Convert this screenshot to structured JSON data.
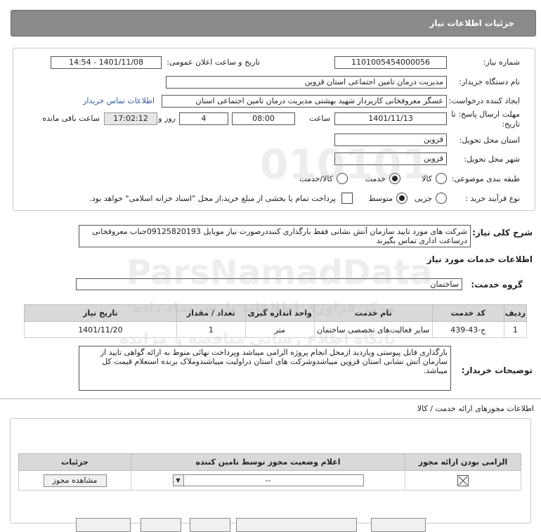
{
  "header": {
    "title": "جزئیات اطلاعات نیاز"
  },
  "form": {
    "need_number_label": "شماره نیاز:",
    "need_number": "1101005454000056",
    "announce_label": "تاریخ و ساعت اعلان عمومی:",
    "announce_value": "1401/11/08 - 14:54",
    "buyer_label": "نام دستگاه خریدار:",
    "buyer_value": "مدیریت درمان تامین اجتماعی استان قزوین",
    "creator_label": "ایجاد کننده درخواست:",
    "creator_value": "عسگر معروفخانی کارپرداز شهید بهشتی مدیریت درمان تامین اجتماعی استان",
    "contact_link": "اطلاعات تماس خریدار",
    "deadline_label": "مهلت ارسال پاسخ: تا تاریخ:",
    "deadline_date": "1401/11/13",
    "time_label": "ساعت",
    "deadline_time": "08:00",
    "days_value": "4",
    "days_label": "روز و",
    "remaining_time": "17:02:12",
    "remaining_label": "ساعت باقی مانده",
    "province_label": "استان محل تحویل:",
    "province_value": "قزوین",
    "city_label": "شهر محل تحویل:",
    "city_value": "قزوین",
    "category_label": "طبقه بندی موضوعی:",
    "category_options": [
      "کالا",
      "خدمت",
      "کالا/خدمت"
    ],
    "process_label": "نوع فرآیند خرید :",
    "process_options": [
      "جزیی",
      "متوسط"
    ],
    "payment_note": "پرداخت تمام یا بخشی از مبلغ خرید،از محل \"اسناد خزانه اسلامی\" خواهد بود."
  },
  "description": {
    "label": "شرح کلی نیاز:",
    "text": "شرکت های مورد تایید سازمان آتش نشانی فقط بارگذاری کنند‌درصورت نیاز موبایل 09125820193جناب معروفخانی درساعت اداری تماس بگیرند"
  },
  "services": {
    "section_title": "اطلاعات خدمات مورد نیاز",
    "group_label": "گروه خدمت:",
    "group_value": "ساختمان",
    "columns": [
      "ردیف",
      "کد خدمت",
      "نام خدمت",
      "واحد اندازه گیری",
      "تعداد / مقدار",
      "تاریخ نیاز"
    ],
    "rows": [
      [
        "1",
        "ج-43-439",
        "سایر فعالیت‌های تخصصی ساختمان",
        "متر",
        "1",
        "1401/11/20"
      ]
    ]
  },
  "buyer_notes": {
    "label": "توضیحات خریدار:",
    "text": "بارگذاری فایل پیوستی وبازدید ازمحل انجام پروژه الزامی میباشد وپرداخت نهائی منوط به ارائه گواهی تایید از سازمان آتش نشانی  استان قزوین میباشدوشرکت های استان دراولیت میباشندوملاک برنده استعلام قیمت کل میباشد."
  },
  "permits": {
    "section_title": "اطلاعات مجوزهای ارائه خدمت / کالا",
    "columns": [
      "الزامی بودن ارائه مجوز",
      "اعلام وضعیت مجوز توسط تامین کننده",
      "جزئیات"
    ],
    "status_value": "--",
    "view_button": "مشاهده مجوز"
  },
  "watermark": {
    "line1": "ParsNamadData",
    "line2": "مرکز فراوری اطلاعات پارس نماد داده",
    "line3": "پایگاه اطلاع رسانی مناقصه و مزایده"
  }
}
